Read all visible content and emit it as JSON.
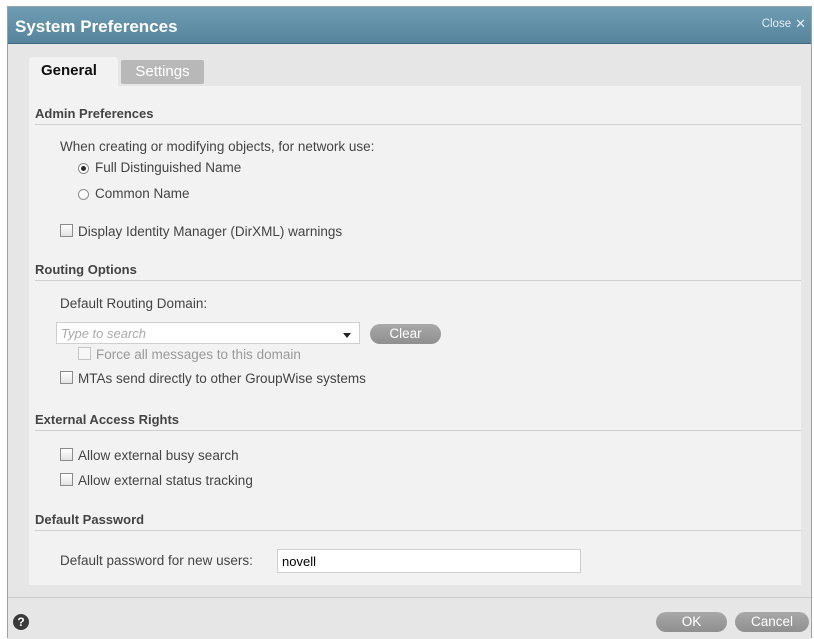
{
  "window": {
    "title": "System Preferences",
    "close_label": "Close",
    "close_glyph": "✕"
  },
  "tabs": [
    {
      "label": "General",
      "active": true
    },
    {
      "label": "Settings",
      "active": false
    }
  ],
  "admin": {
    "heading": "Admin Preferences",
    "prompt": "When creating or modifying objects, for network use:",
    "options": [
      {
        "label": "Full Distinguished Name",
        "checked": true
      },
      {
        "label": "Common Name",
        "checked": false
      }
    ],
    "idm_warnings_label": "Display Identity Manager (DirXML) warnings"
  },
  "routing": {
    "heading": "Routing Options",
    "domain_label": "Default Routing Domain:",
    "domain_placeholder": "Type to search",
    "clear_label": "Clear",
    "force_label": "Force all messages to this domain",
    "mta_label": "MTAs send directly to other GroupWise systems"
  },
  "external": {
    "heading": "External Access Rights",
    "busy_label": "Allow external busy search",
    "status_label": "Allow external status tracking"
  },
  "password": {
    "heading": "Default Password",
    "label": "Default password for new users:",
    "value": "novell"
  },
  "footer": {
    "help_glyph": "?",
    "ok_label": "OK",
    "cancel_label": "Cancel"
  }
}
